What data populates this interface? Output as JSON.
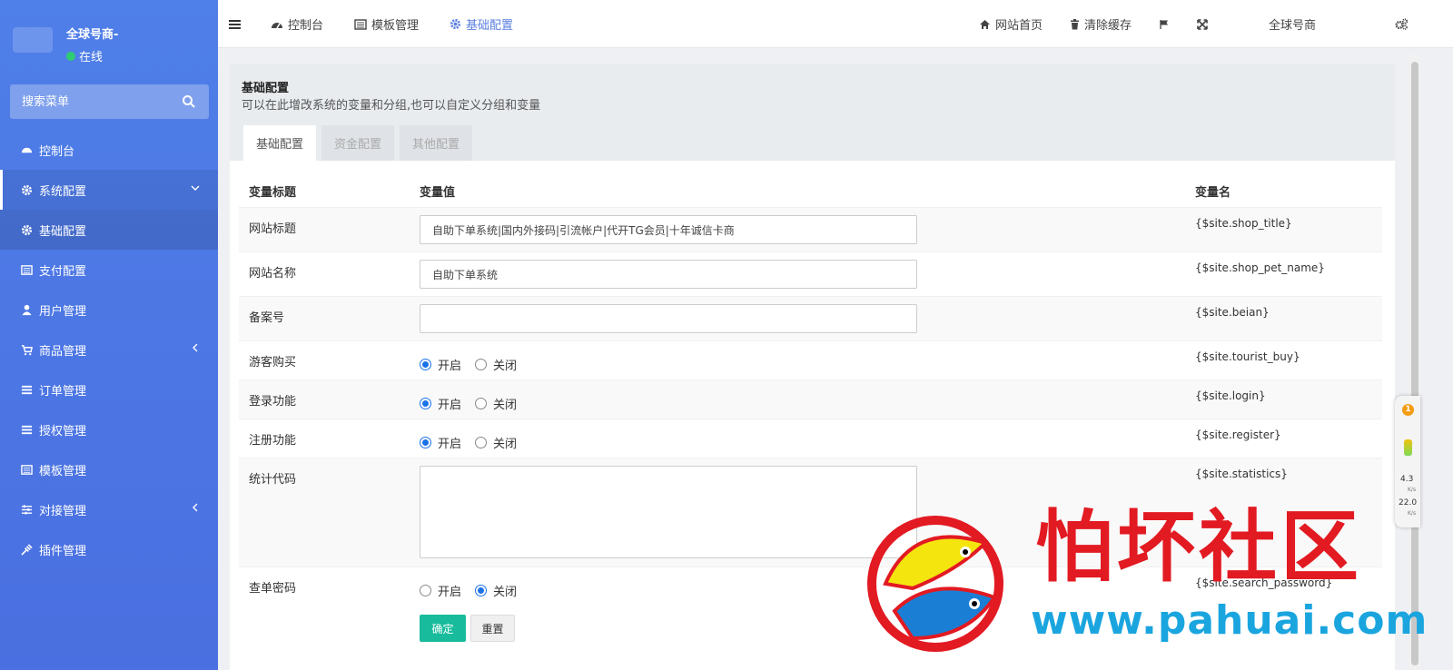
{
  "sidebar": {
    "user_name": "全球号商-",
    "status": "在线",
    "search_placeholder": "搜索菜单",
    "menu": [
      {
        "label": "控制台",
        "icon": "dashboard-icon"
      },
      {
        "label": "系统配置",
        "icon": "gear-icon"
      },
      {
        "label": "基础配置",
        "icon": "gear-icon"
      },
      {
        "label": "支付配置",
        "icon": "list-icon"
      },
      {
        "label": "用户管理",
        "icon": "user-icon"
      },
      {
        "label": "商品管理",
        "icon": "cart-icon"
      },
      {
        "label": "订单管理",
        "icon": "bars-icon"
      },
      {
        "label": "授权管理",
        "icon": "bars-icon"
      },
      {
        "label": "模板管理",
        "icon": "list-icon"
      },
      {
        "label": "对接管理",
        "icon": "sliders-icon"
      },
      {
        "label": "插件管理",
        "icon": "plug-icon"
      }
    ]
  },
  "topbar": {
    "tabs": [
      {
        "label": "控制台",
        "icon": "dashboard-icon"
      },
      {
        "label": "模板管理",
        "icon": "list-icon"
      },
      {
        "label": "基础配置",
        "icon": "gear-icon"
      }
    ],
    "home_label": "网站首页",
    "clear_cache_label": "清除缓存",
    "user_label": "全球号商"
  },
  "content": {
    "title": "基础配置",
    "description": "可以在此增改系统的变量和分组,也可以自定义分组和变量",
    "tabs": [
      "基础配置",
      "资金配置",
      "其他配置"
    ],
    "columns": [
      "变量标题",
      "变量值",
      "变量名"
    ],
    "rows": [
      {
        "label": "网站标题",
        "value": "自助下单系统|国内外接码|引流帐户|代开TG会员|十年诚信卡商",
        "var": "{$site.shop_title}"
      },
      {
        "label": "网站名称",
        "value": "自助下单系统",
        "var": "{$site.shop_pet_name}"
      },
      {
        "label": "备案号",
        "value": "",
        "var": "{$site.beian}"
      },
      {
        "label": "游客购买",
        "var": "{$site.tourist_buy}"
      },
      {
        "label": "登录功能",
        "var": "{$site.login}"
      },
      {
        "label": "注册功能",
        "var": "{$site.register}"
      },
      {
        "label": "统计代码",
        "var": "{$site.statistics}"
      },
      {
        "label": "查单密码",
        "var": "{$site.search_password}"
      }
    ],
    "radio_on": "开启",
    "radio_off": "关闭",
    "radio_states": [
      "on",
      "on",
      "on",
      "off"
    ],
    "submit_label": "确定",
    "reset_label": "重置"
  },
  "float_widget": {
    "badge": "1",
    "speed_up": "4.3",
    "speed_down": "22.0",
    "unit": "K/s"
  },
  "watermark": {
    "title": "怕坏社区",
    "url": "www.pahuai.com"
  },
  "colors": {
    "sidebar": "#4f7fe8",
    "accent": "#5b7fe0",
    "ok_button": "#18bc9c",
    "watermark_red": "#e21a22",
    "watermark_blue": "#1aa5df"
  }
}
